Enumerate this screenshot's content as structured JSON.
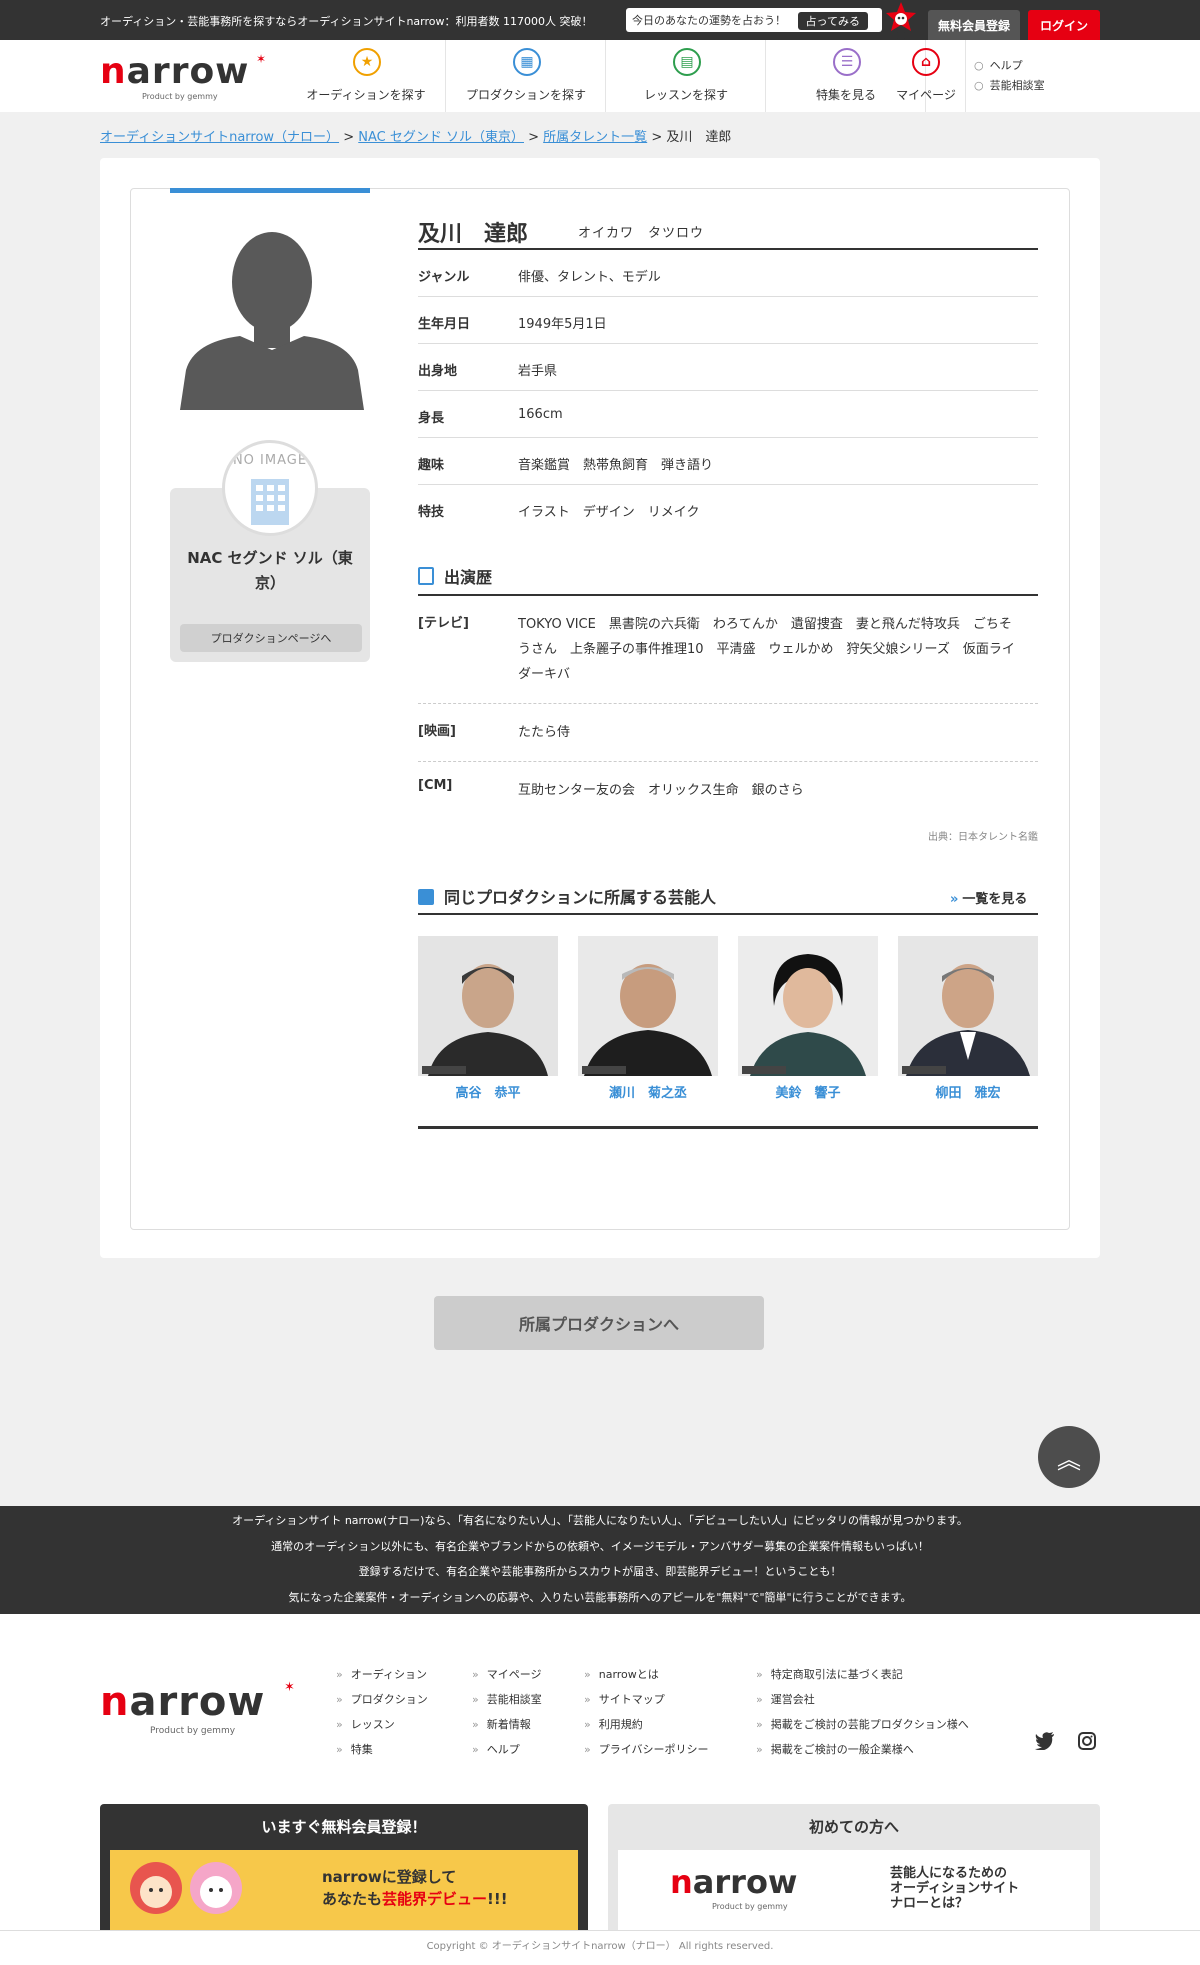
{
  "topbar": {
    "tagline": "オーディション・芸能事務所を探すならオーディションサイトnarrow：利用者数 117000人 突破！",
    "fortune_text": "今日のあなたの運勢を占おう！",
    "fortune_button": "占ってみる",
    "register": "無料会員登録",
    "login": "ログイン"
  },
  "header": {
    "logo_word": "arrow",
    "logo_n": "n",
    "logo_sub": "Product by gemmy",
    "nav": [
      {
        "label": "オーディションを探す",
        "icon": "star-icon",
        "color": "#f0a000"
      },
      {
        "label": "プロダクションを探す",
        "icon": "building-icon",
        "color": "#3a8fd6"
      },
      {
        "label": "レッスンを探す",
        "icon": "lesson-icon",
        "color": "#2e9e4e"
      },
      {
        "label": "特集を見る",
        "icon": "feature-icon",
        "color": "#9a6fc9"
      },
      {
        "label": "マイページ",
        "icon": "home-icon",
        "color": "#e60012"
      }
    ],
    "side": [
      "ヘルプ",
      "芸能相談室"
    ]
  },
  "breadcrumb": {
    "items": [
      "オーディションサイトnarrow（ナロー）",
      "NAC セグンド ソル（東京）",
      "所属タレント一覧"
    ],
    "current": "及川　達郎",
    "sep": ">"
  },
  "profile": {
    "name": "及川　達郎",
    "kana": "オイカワ　タツロウ",
    "rows": [
      {
        "k": "ジャンル",
        "v": "俳優、タレント、モデル"
      },
      {
        "k": "生年月日",
        "v": "1949年5月1日"
      },
      {
        "k": "出身地",
        "v": "岩手県"
      },
      {
        "k": "身長",
        "v": "166cm"
      },
      {
        "k": "趣味",
        "v": "音楽鑑賞　熱帯魚飼育　弾き語り"
      },
      {
        "k": "特技",
        "v": "イラスト　デザイン　リメイク"
      }
    ]
  },
  "production": {
    "no_image": "NO IMAGE",
    "name": "NAC セグンド ソル（東京）",
    "button": "プロダクションページへ"
  },
  "career": {
    "title": "出演歴",
    "rows": [
      {
        "k": "[テレビ]",
        "v": "TOKYO VICE　黒書院の六兵衛　わろてんか　遺留捜査　妻と飛んだ特攻兵　ごちそうさん　上条麗子の事件推理10　平清盛　ウェルかめ　狩矢父娘シリーズ　仮面ライダーキバ"
      },
      {
        "k": "[映画]",
        "v": "たたら侍"
      },
      {
        "k": "[CM]",
        "v": "互助センター友の会　オリックス生命　銀のさら"
      }
    ],
    "source": "出典：日本タレント名鑑"
  },
  "same_production": {
    "title": "同じプロダクションに所属する芸能人",
    "see_all": "一覧を見る",
    "talents": [
      {
        "name": "高谷　恭平"
      },
      {
        "name": "瀬川　菊之丞"
      },
      {
        "name": "美鈴　響子"
      },
      {
        "name": "柳田　雅宏"
      }
    ],
    "photo_credit": "日本タレント名鑑"
  },
  "actions": {
    "to_production": "所属プロダクションへ",
    "to_top": "︽"
  },
  "band": [
    "オーディションサイト narrow(ナロー)なら、「有名になりたい人」、「芸能人になりたい人」、「デビューしたい人」にピッタリの情報が見つかります。",
    "通常のオーディション以外にも、有名企業やブランドからの依頼や、イメージモデル・アンバサダー募集の企業案件情報もいっぱい！",
    "登録するだけで、有名企業や芸能事務所からスカウトが届き、即芸能界デビュー！ということも！",
    "気になった企業案件・オーディションへの応募や、入りたい芸能事務所へのアピールを\"無料\"で\"簡単\"に行うことができます。"
  ],
  "footer": {
    "col1": [
      "オーディション",
      "プロダクション",
      "レッスン",
      "特集"
    ],
    "col2": [
      "マイページ",
      "芸能相談室",
      "新着情報",
      "ヘルプ"
    ],
    "col3": [
      "narrowとは",
      "サイトマップ",
      "利用規約",
      "プライバシーポリシー"
    ],
    "col4": [
      "特定商取引法に基づく表記",
      "運営会社",
      "掲載をご検討の芸能プロダクション様へ",
      "掲載をご検討の一般企業様へ"
    ],
    "register_box": {
      "title": "いますぐ無料会員登録！",
      "line1": "narrowに登録して",
      "line2a": "あなたも",
      "line2b": "芸能界デビュー",
      "line2c": "!!!"
    },
    "first_box": {
      "title": "初めての方へ",
      "text1": "芸能人になるための",
      "text2": "オーディションサイト",
      "text3": "ナローとは？"
    },
    "copyright": "Copyright © オーディションサイトnarrow（ナロー） All rights reserved."
  },
  "colors": {
    "accent": "#3a8fd6",
    "brand_red": "#e60012",
    "dark": "#333333"
  }
}
